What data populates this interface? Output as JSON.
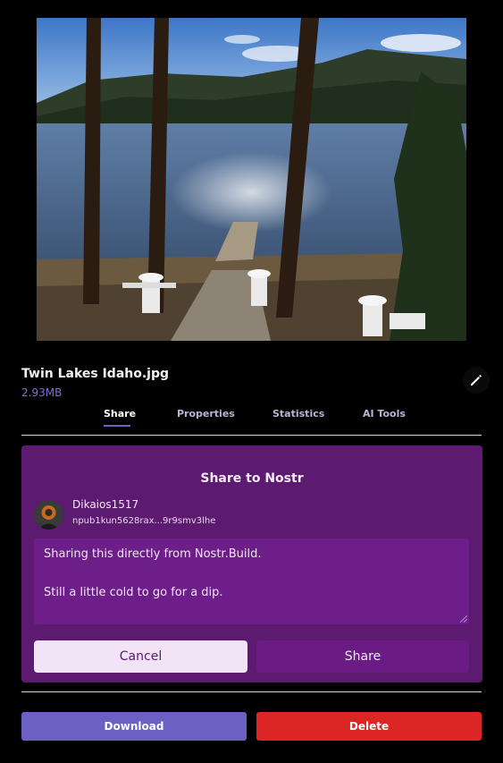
{
  "file": {
    "name": "Twin Lakes Idaho.jpg",
    "size": "2.93MB",
    "edit_icon": "pencil-icon"
  },
  "tabs": [
    {
      "label": "Share",
      "active": true
    },
    {
      "label": "Properties",
      "active": false
    },
    {
      "label": "Statistics",
      "active": false
    },
    {
      "label": "AI Tools",
      "active": false
    }
  ],
  "share_panel": {
    "title": "Share to Nostr",
    "user": {
      "name": "Dikaios1517",
      "npub": "npub1kun5628rax...9r9smv3lhe"
    },
    "message_lines": [
      "Sharing this directly from Nostr.Build.",
      "",
      "Still a little cold to go for a dip."
    ],
    "cancel_label": "Cancel",
    "share_label": "Share"
  },
  "actions": {
    "download_label": "Download",
    "delete_label": "Delete"
  },
  "colors": {
    "accent": "#6c61c2",
    "panel": "#5c1a71",
    "danger": "#dc2626"
  }
}
